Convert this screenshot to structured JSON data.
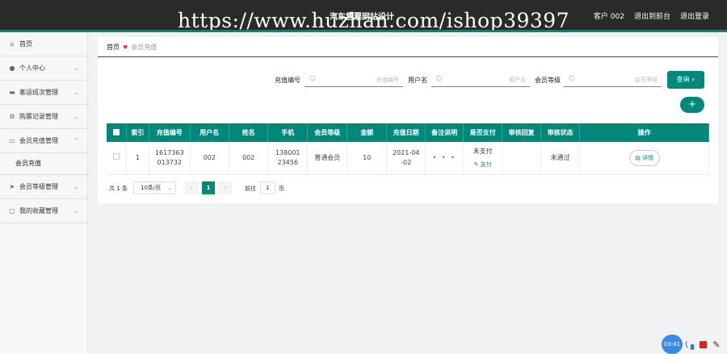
{
  "topbar": {
    "watermark": "https://www.huzhan.com/ishop39397",
    "site_title": "汽车售票网站设计",
    "user": "客户 002",
    "back_label": "退出到前台",
    "logout_label": "退出登录",
    "accent_color": "#00897b"
  },
  "sidebar": {
    "items": [
      {
        "label": "首页",
        "icon": "home-icon"
      },
      {
        "label": "个人中心",
        "icon": "user-icon"
      },
      {
        "label": "客运班次管理",
        "icon": "monitor-icon"
      },
      {
        "label": "购票记录管理",
        "icon": "gear-icon"
      },
      {
        "label": "会员充值管理",
        "icon": "card-icon",
        "expanded": true
      },
      {
        "label": "会员等级管理",
        "icon": "send-icon"
      },
      {
        "label": "我的收藏管理",
        "icon": "chat-icon"
      }
    ],
    "sub_item": "会员充值"
  },
  "breadcrumb": {
    "home": "首页",
    "current": "会员充值"
  },
  "search": {
    "fields": [
      {
        "label": "充值编号",
        "placeholder": "充值编号"
      },
      {
        "label": "用户名",
        "placeholder": "用户名"
      },
      {
        "label": "会员等级",
        "placeholder": "会员等级"
      }
    ],
    "query_label": "查询",
    "add_label": "+"
  },
  "table": {
    "columns": [
      "索引",
      "充值编号",
      "用户名",
      "姓名",
      "手机",
      "会员等级",
      "金额",
      "充值日期",
      "备注说明",
      "是否支付",
      "审核回复",
      "审核状态",
      "操作"
    ],
    "rows": [
      {
        "index": "1",
        "recharge_no": "1617363013732",
        "username": "002",
        "name": "002",
        "phone": "13800123456",
        "level": "普通会员",
        "amount": "10",
        "date": "2021-04-02",
        "remark": "• • •",
        "pay_status": "未支付",
        "pay_action": "支付",
        "review_reply": "",
        "review_status": "未通过",
        "detail_label": "详情"
      }
    ]
  },
  "pagination": {
    "total": "共 1 条",
    "page_size": "10条/页",
    "current_page": "1",
    "goto_label": "前往",
    "goto_value": "1",
    "page_unit": "页"
  },
  "widget": {
    "clock": "03:41"
  }
}
